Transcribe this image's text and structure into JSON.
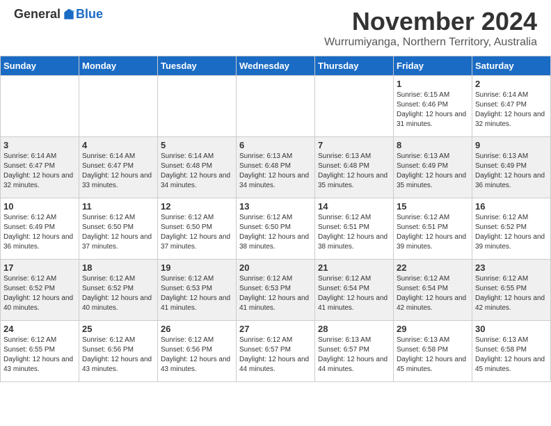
{
  "logo": {
    "general": "General",
    "blue": "Blue"
  },
  "title": "November 2024",
  "location": "Wurrumiyanga, Northern Territory, Australia",
  "days_of_week": [
    "Sunday",
    "Monday",
    "Tuesday",
    "Wednesday",
    "Thursday",
    "Friday",
    "Saturday"
  ],
  "weeks": [
    [
      {
        "day": "",
        "info": ""
      },
      {
        "day": "",
        "info": ""
      },
      {
        "day": "",
        "info": ""
      },
      {
        "day": "",
        "info": ""
      },
      {
        "day": "",
        "info": ""
      },
      {
        "day": "1",
        "info": "Sunrise: 6:15 AM\nSunset: 6:46 PM\nDaylight: 12 hours and 31 minutes."
      },
      {
        "day": "2",
        "info": "Sunrise: 6:14 AM\nSunset: 6:47 PM\nDaylight: 12 hours and 32 minutes."
      }
    ],
    [
      {
        "day": "3",
        "info": "Sunrise: 6:14 AM\nSunset: 6:47 PM\nDaylight: 12 hours and 32 minutes."
      },
      {
        "day": "4",
        "info": "Sunrise: 6:14 AM\nSunset: 6:47 PM\nDaylight: 12 hours and 33 minutes."
      },
      {
        "day": "5",
        "info": "Sunrise: 6:14 AM\nSunset: 6:48 PM\nDaylight: 12 hours and 34 minutes."
      },
      {
        "day": "6",
        "info": "Sunrise: 6:13 AM\nSunset: 6:48 PM\nDaylight: 12 hours and 34 minutes."
      },
      {
        "day": "7",
        "info": "Sunrise: 6:13 AM\nSunset: 6:48 PM\nDaylight: 12 hours and 35 minutes."
      },
      {
        "day": "8",
        "info": "Sunrise: 6:13 AM\nSunset: 6:49 PM\nDaylight: 12 hours and 35 minutes."
      },
      {
        "day": "9",
        "info": "Sunrise: 6:13 AM\nSunset: 6:49 PM\nDaylight: 12 hours and 36 minutes."
      }
    ],
    [
      {
        "day": "10",
        "info": "Sunrise: 6:12 AM\nSunset: 6:49 PM\nDaylight: 12 hours and 36 minutes."
      },
      {
        "day": "11",
        "info": "Sunrise: 6:12 AM\nSunset: 6:50 PM\nDaylight: 12 hours and 37 minutes."
      },
      {
        "day": "12",
        "info": "Sunrise: 6:12 AM\nSunset: 6:50 PM\nDaylight: 12 hours and 37 minutes."
      },
      {
        "day": "13",
        "info": "Sunrise: 6:12 AM\nSunset: 6:50 PM\nDaylight: 12 hours and 38 minutes."
      },
      {
        "day": "14",
        "info": "Sunrise: 6:12 AM\nSunset: 6:51 PM\nDaylight: 12 hours and 38 minutes."
      },
      {
        "day": "15",
        "info": "Sunrise: 6:12 AM\nSunset: 6:51 PM\nDaylight: 12 hours and 39 minutes."
      },
      {
        "day": "16",
        "info": "Sunrise: 6:12 AM\nSunset: 6:52 PM\nDaylight: 12 hours and 39 minutes."
      }
    ],
    [
      {
        "day": "17",
        "info": "Sunrise: 6:12 AM\nSunset: 6:52 PM\nDaylight: 12 hours and 40 minutes."
      },
      {
        "day": "18",
        "info": "Sunrise: 6:12 AM\nSunset: 6:52 PM\nDaylight: 12 hours and 40 minutes."
      },
      {
        "day": "19",
        "info": "Sunrise: 6:12 AM\nSunset: 6:53 PM\nDaylight: 12 hours and 41 minutes."
      },
      {
        "day": "20",
        "info": "Sunrise: 6:12 AM\nSunset: 6:53 PM\nDaylight: 12 hours and 41 minutes."
      },
      {
        "day": "21",
        "info": "Sunrise: 6:12 AM\nSunset: 6:54 PM\nDaylight: 12 hours and 41 minutes."
      },
      {
        "day": "22",
        "info": "Sunrise: 6:12 AM\nSunset: 6:54 PM\nDaylight: 12 hours and 42 minutes."
      },
      {
        "day": "23",
        "info": "Sunrise: 6:12 AM\nSunset: 6:55 PM\nDaylight: 12 hours and 42 minutes."
      }
    ],
    [
      {
        "day": "24",
        "info": "Sunrise: 6:12 AM\nSunset: 6:55 PM\nDaylight: 12 hours and 43 minutes."
      },
      {
        "day": "25",
        "info": "Sunrise: 6:12 AM\nSunset: 6:56 PM\nDaylight: 12 hours and 43 minutes."
      },
      {
        "day": "26",
        "info": "Sunrise: 6:12 AM\nSunset: 6:56 PM\nDaylight: 12 hours and 43 minutes."
      },
      {
        "day": "27",
        "info": "Sunrise: 6:12 AM\nSunset: 6:57 PM\nDaylight: 12 hours and 44 minutes."
      },
      {
        "day": "28",
        "info": "Sunrise: 6:13 AM\nSunset: 6:57 PM\nDaylight: 12 hours and 44 minutes."
      },
      {
        "day": "29",
        "info": "Sunrise: 6:13 AM\nSunset: 6:58 PM\nDaylight: 12 hours and 45 minutes."
      },
      {
        "day": "30",
        "info": "Sunrise: 6:13 AM\nSunset: 6:58 PM\nDaylight: 12 hours and 45 minutes."
      }
    ]
  ]
}
